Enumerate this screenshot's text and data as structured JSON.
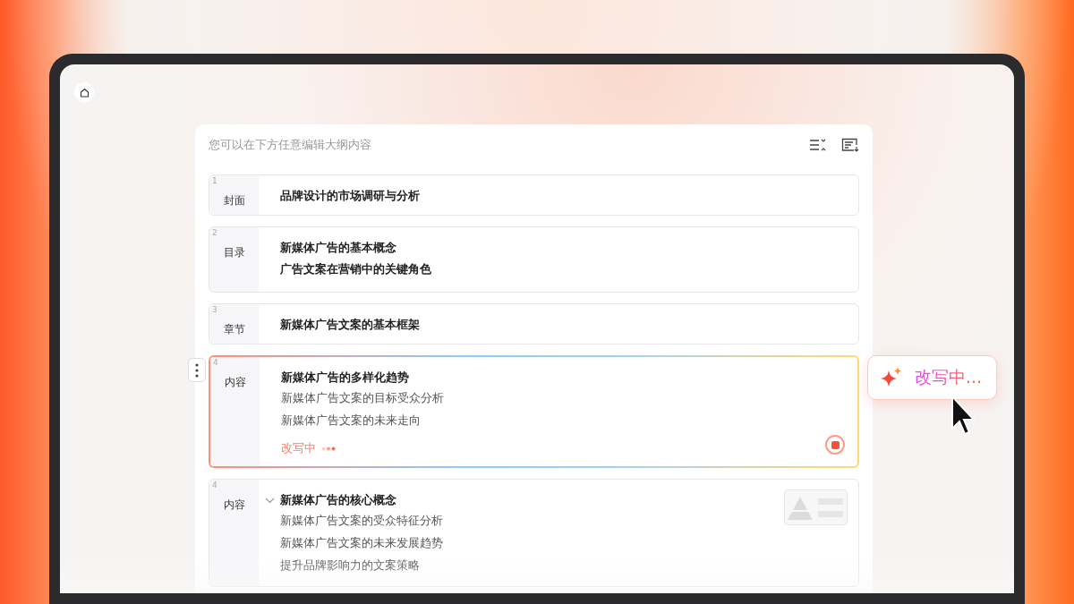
{
  "instruction": "您可以在下方任意编辑大纲内容",
  "sections": [
    {
      "kind": "plain",
      "number": "1",
      "label": "封面",
      "title": "品牌设计的市场调研与分析"
    },
    {
      "kind": "plain",
      "number": "2",
      "label": "目录",
      "title": "新媒体广告的基本概念",
      "items": [
        "广告文案在营销中的关键角色"
      ]
    },
    {
      "kind": "plain",
      "number": "3",
      "label": "章节",
      "title": "新媒体广告文案的基本框架"
    },
    {
      "kind": "rewriting",
      "number": "4",
      "label": "内容",
      "title": "新媒体广告的多样化趋势",
      "items": [
        "新媒体广告文案的目标受众分析",
        "新媒体广告文案的未来走向"
      ],
      "status_text": "改写中",
      "bubble_text": "改写中..."
    },
    {
      "kind": "expandable",
      "number": "4",
      "label": "内容",
      "title": "新媒体广告的核心概念",
      "expanded": true,
      "items": [
        "新媒体广告文案的受众特征分析",
        "新媒体广告文案的未来发展趋势",
        "提升品牌影响力的文案策略"
      ]
    }
  ]
}
